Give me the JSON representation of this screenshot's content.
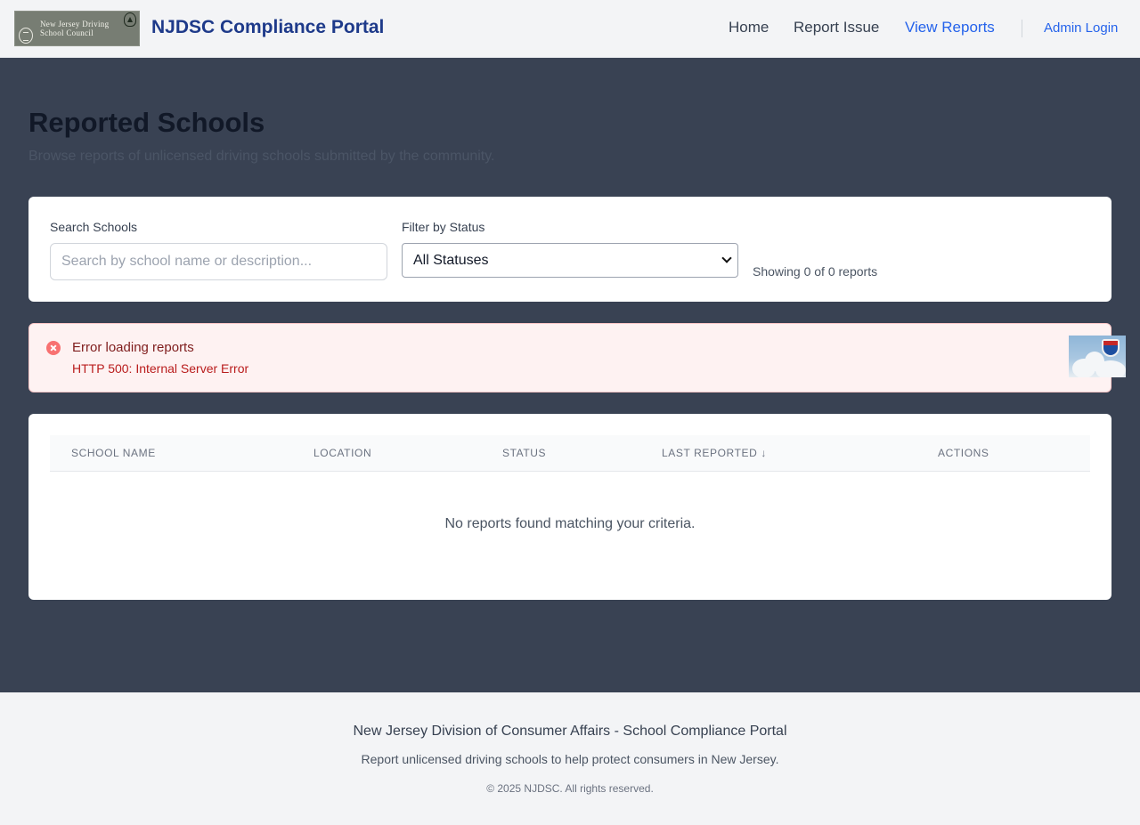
{
  "header": {
    "logo_text_line1": "New Jersey Driving",
    "logo_text_line2": "School Council",
    "brand": "NJDSC Compliance Portal",
    "nav": [
      "Home",
      "Report Issue",
      "View Reports"
    ],
    "admin_login": "Admin Login"
  },
  "page": {
    "title": "Reported Schools",
    "subtitle": "Browse reports of unlicensed driving schools submitted by the community."
  },
  "filters": {
    "search_label": "Search Schools",
    "search_placeholder": "Search by school name or description...",
    "search_value": "",
    "status_label": "Filter by Status",
    "status_selected": "All Statuses",
    "showing": "Showing 0 of 0 reports"
  },
  "error": {
    "title": "Error loading reports",
    "message": "HTTP 500: Internal Server Error"
  },
  "table": {
    "columns": [
      "School Name",
      "Location",
      "Status",
      "Last Reported ↓",
      "Actions"
    ],
    "empty_message": "No reports found matching your criteria.",
    "rows": []
  },
  "footer": {
    "line1": "New Jersey Division of Consumer Affairs - School Compliance Portal",
    "line2": "Report unlicensed driving schools to help protect consumers in New Jersey.",
    "copyright": "© 2025 NJDSC. All rights reserved."
  },
  "colors": {
    "brand": "#1e3a8a",
    "link": "#2563eb",
    "main_bg": "#394253",
    "error_bg": "#fef2f2",
    "error_text": "#b91c1c"
  }
}
